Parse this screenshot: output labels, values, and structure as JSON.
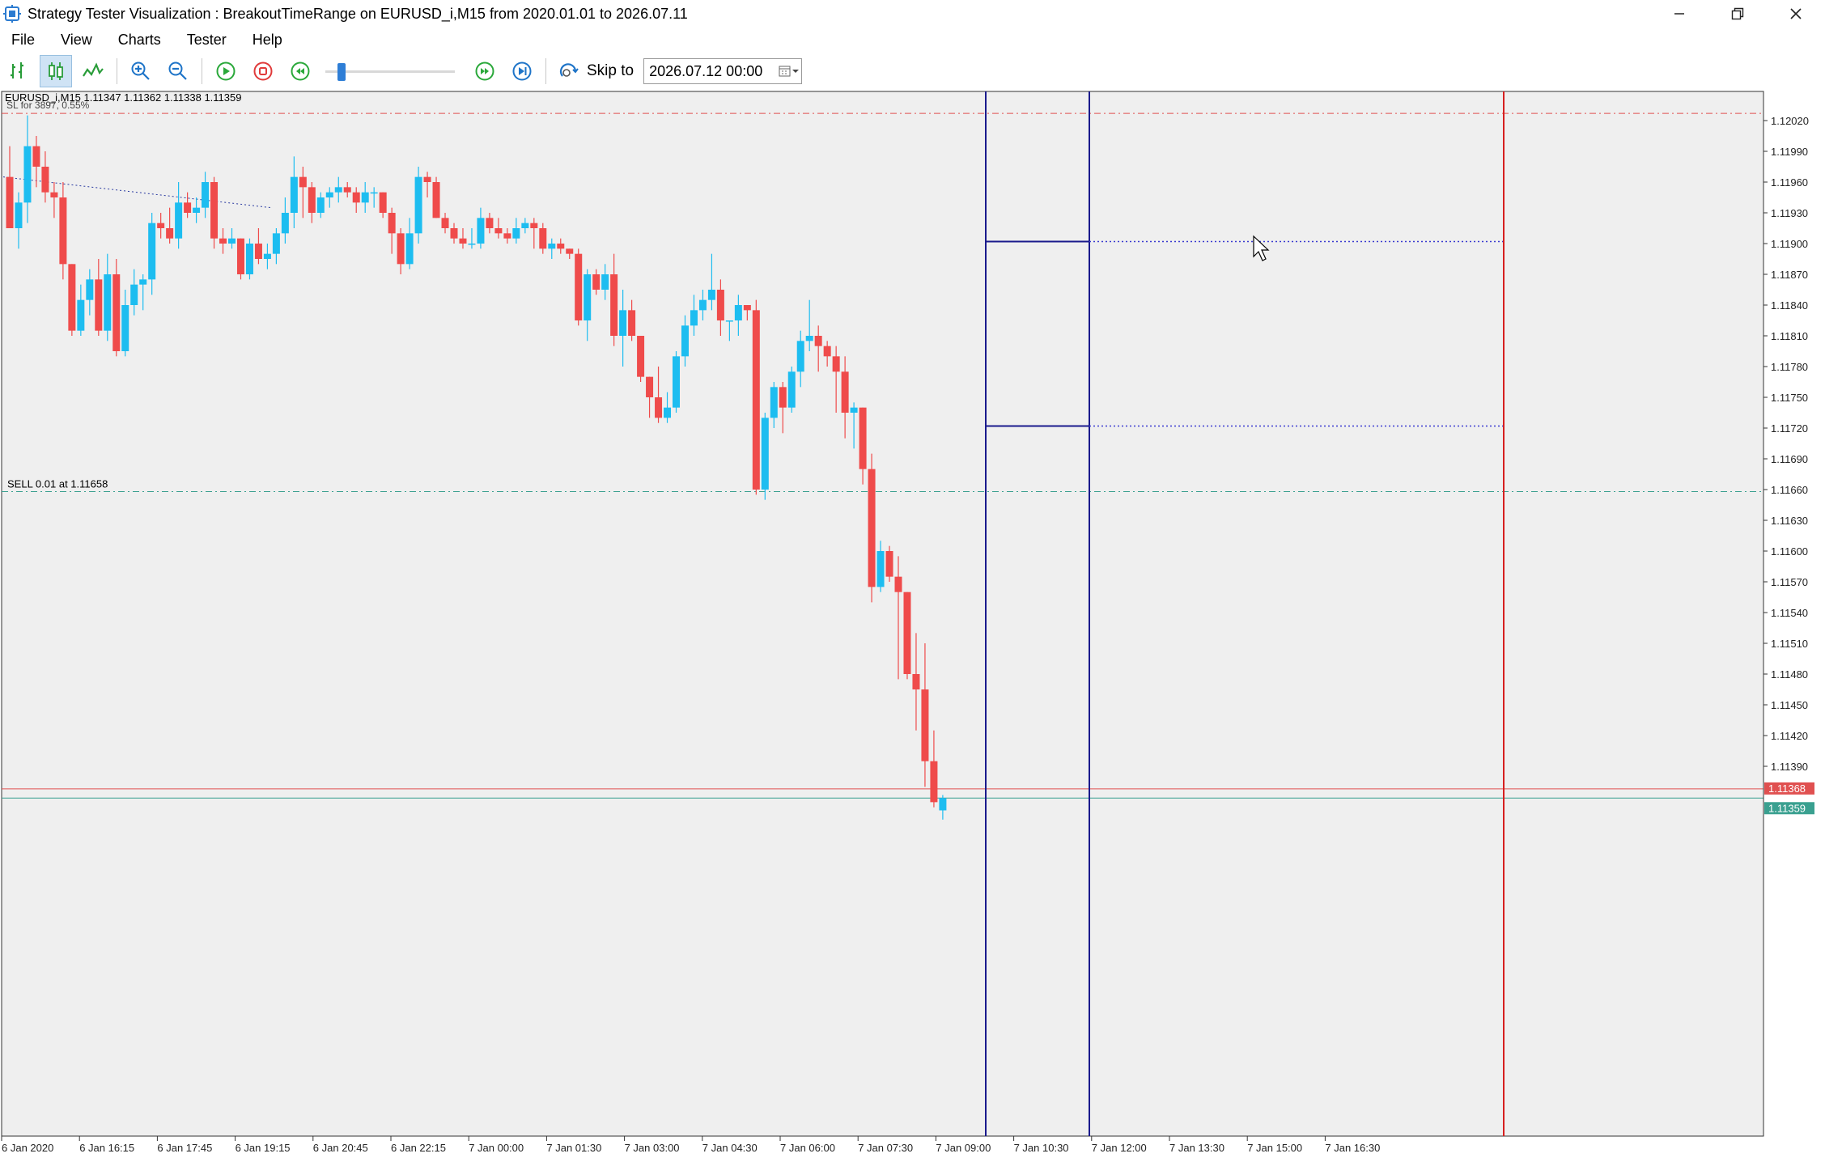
{
  "window": {
    "title": "Strategy Tester Visualization : BreakoutTimeRange on EURUSD_i,M15 from 2020.01.01 to 2026.07.11",
    "minimize_icon": "minimize-icon",
    "restore_icon": "restore-icon",
    "close_icon": "close-icon"
  },
  "menu": [
    {
      "label": "File"
    },
    {
      "label": "View"
    },
    {
      "label": "Charts"
    },
    {
      "label": "Tester"
    },
    {
      "label": "Help"
    }
  ],
  "toolbar": {
    "skip_label": "Skip to",
    "date_value": "2026.07.12 00:00",
    "speed": 0.1
  },
  "chart": {
    "info": "EURUSD_i,M15 1.11347 1.11362 1.11338 1.11359",
    "sl_text": "SL for 3897, 0.55%",
    "sell_text": "SELL 0.01 at 1.11658",
    "colors": {
      "bull": "#1dbdf0",
      "bear": "#ef4b4b",
      "bg": "#efefef",
      "range": "#1a1a8c",
      "vline": "#d61f1f"
    },
    "price_axis": [
      "1.12020",
      "1.11990",
      "1.11960",
      "1.11930",
      "1.11900",
      "1.11870",
      "1.11840",
      "1.11810",
      "1.11780",
      "1.11750",
      "1.11720",
      "1.11690",
      "1.11660",
      "1.11630",
      "1.11600",
      "1.11570",
      "1.11540",
      "1.11510",
      "1.11480",
      "1.11450",
      "1.11420",
      "1.11390"
    ],
    "time_axis": [
      "6 Jan 2020",
      "6 Jan 16:15",
      "6 Jan 17:45",
      "6 Jan 19:15",
      "6 Jan 20:45",
      "6 Jan 22:15",
      "7 Jan 00:00",
      "7 Jan 01:30",
      "7 Jan 03:00",
      "7 Jan 04:30",
      "7 Jan 06:00",
      "7 Jan 07:30",
      "7 Jan 09:00",
      "7 Jan 10:30",
      "7 Jan 12:00",
      "7 Jan 13:30",
      "7 Jan 15:00",
      "7 Jan 16:30"
    ],
    "ask_label": "1.11368",
    "bid_label": "1.11359",
    "levels": {
      "sl": 1.12027,
      "sell": 1.11658,
      "ask": 1.11368,
      "bid": 1.11359,
      "range_high": 1.11902,
      "range_low": 1.11722
    },
    "candles": [
      [
        1.11965,
        1.11995,
        1.11915,
        1.11915
      ],
      [
        1.11915,
        1.1195,
        1.11895,
        1.1194
      ],
      [
        1.1194,
        1.12025,
        1.1192,
        1.11995
      ],
      [
        1.11995,
        1.12005,
        1.11955,
        1.11975
      ],
      [
        1.11975,
        1.1199,
        1.1194,
        1.1195
      ],
      [
        1.1195,
        1.1196,
        1.11925,
        1.11945
      ],
      [
        1.11945,
        1.1196,
        1.11865,
        1.1188
      ],
      [
        1.1188,
        1.1188,
        1.1181,
        1.11815
      ],
      [
        1.11815,
        1.1186,
        1.1181,
        1.11845
      ],
      [
        1.11845,
        1.11875,
        1.1183,
        1.11865
      ],
      [
        1.11865,
        1.11885,
        1.1181,
        1.11815
      ],
      [
        1.11815,
        1.1189,
        1.11805,
        1.1187
      ],
      [
        1.1187,
        1.11885,
        1.1179,
        1.11795
      ],
      [
        1.11795,
        1.11855,
        1.1179,
        1.1184
      ],
      [
        1.1184,
        1.11875,
        1.1183,
        1.1186
      ],
      [
        1.1186,
        1.1187,
        1.11835,
        1.11865
      ],
      [
        1.11865,
        1.1193,
        1.1185,
        1.1192
      ],
      [
        1.1192,
        1.1193,
        1.11905,
        1.11915
      ],
      [
        1.11915,
        1.11935,
        1.119,
        1.11905
      ],
      [
        1.11905,
        1.1196,
        1.11895,
        1.1194
      ],
      [
        1.1194,
        1.1195,
        1.11925,
        1.1193
      ],
      [
        1.1193,
        1.11945,
        1.1192,
        1.11935
      ],
      [
        1.11935,
        1.1197,
        1.11925,
        1.1196
      ],
      [
        1.1196,
        1.11965,
        1.11895,
        1.11905
      ],
      [
        1.11905,
        1.11915,
        1.1189,
        1.119
      ],
      [
        1.119,
        1.11915,
        1.11895,
        1.11905
      ],
      [
        1.11905,
        1.11905,
        1.11865,
        1.1187
      ],
      [
        1.1187,
        1.11905,
        1.11865,
        1.119
      ],
      [
        1.119,
        1.11915,
        1.1188,
        1.11885
      ],
      [
        1.11885,
        1.119,
        1.11875,
        1.1189
      ],
      [
        1.1189,
        1.11915,
        1.1188,
        1.1191
      ],
      [
        1.1191,
        1.11945,
        1.119,
        1.1193
      ],
      [
        1.1193,
        1.11985,
        1.11915,
        1.11965
      ],
      [
        1.11965,
        1.11975,
        1.11925,
        1.11955
      ],
      [
        1.11955,
        1.1196,
        1.1192,
        1.1193
      ],
      [
        1.1193,
        1.1195,
        1.11925,
        1.11945
      ],
      [
        1.11945,
        1.11955,
        1.11935,
        1.1195
      ],
      [
        1.1195,
        1.11965,
        1.1194,
        1.11955
      ],
      [
        1.11955,
        1.1196,
        1.11945,
        1.1195
      ],
      [
        1.1195,
        1.11955,
        1.1193,
        1.1194
      ],
      [
        1.1194,
        1.1196,
        1.1193,
        1.1195
      ],
      [
        1.1195,
        1.11955,
        1.11935,
        1.1195
      ],
      [
        1.1195,
        1.1195,
        1.11925,
        1.1193
      ],
      [
        1.1193,
        1.11935,
        1.1189,
        1.1191
      ],
      [
        1.1191,
        1.11915,
        1.1187,
        1.1188
      ],
      [
        1.1188,
        1.11925,
        1.11875,
        1.1191
      ],
      [
        1.1191,
        1.11975,
        1.119,
        1.11965
      ],
      [
        1.11965,
        1.1197,
        1.11945,
        1.1196
      ],
      [
        1.1196,
        1.11965,
        1.11925,
        1.11925
      ],
      [
        1.11925,
        1.1193,
        1.1191,
        1.11915
      ],
      [
        1.11915,
        1.1192,
        1.119,
        1.11905
      ],
      [
        1.11905,
        1.11915,
        1.11895,
        1.119
      ],
      [
        1.119,
        1.11915,
        1.11895,
        1.119
      ],
      [
        1.119,
        1.11935,
        1.11895,
        1.11925
      ],
      [
        1.11925,
        1.1193,
        1.1191,
        1.11915
      ],
      [
        1.11915,
        1.11925,
        1.11905,
        1.1191
      ],
      [
        1.1191,
        1.11915,
        1.119,
        1.11905
      ],
      [
        1.11905,
        1.11925,
        1.119,
        1.11915
      ],
      [
        1.11915,
        1.11925,
        1.1191,
        1.1192
      ],
      [
        1.1192,
        1.11925,
        1.11895,
        1.11915
      ],
      [
        1.11915,
        1.1192,
        1.1189,
        1.11895
      ],
      [
        1.11895,
        1.11905,
        1.11885,
        1.119
      ],
      [
        1.119,
        1.11905,
        1.1189,
        1.11895
      ],
      [
        1.11895,
        1.11895,
        1.11885,
        1.1189
      ],
      [
        1.1189,
        1.11895,
        1.1182,
        1.11825
      ],
      [
        1.11825,
        1.11875,
        1.11805,
        1.1187
      ],
      [
        1.1187,
        1.11875,
        1.1185,
        1.11855
      ],
      [
        1.11855,
        1.1188,
        1.11845,
        1.1187
      ],
      [
        1.1187,
        1.1189,
        1.118,
        1.1181
      ],
      [
        1.1181,
        1.11855,
        1.1178,
        1.11835
      ],
      [
        1.11835,
        1.11845,
        1.11805,
        1.1181
      ],
      [
        1.1181,
        1.1181,
        1.11765,
        1.1177
      ],
      [
        1.1177,
        1.1177,
        1.1173,
        1.1175
      ],
      [
        1.1175,
        1.1178,
        1.11725,
        1.1173
      ],
      [
        1.1173,
        1.11755,
        1.11725,
        1.1174
      ],
      [
        1.1174,
        1.11795,
        1.11735,
        1.1179
      ],
      [
        1.1179,
        1.1183,
        1.1178,
        1.1182
      ],
      [
        1.1182,
        1.1185,
        1.1181,
        1.11835
      ],
      [
        1.11835,
        1.11855,
        1.11825,
        1.11845
      ],
      [
        1.11845,
        1.1189,
        1.11835,
        1.11855
      ],
      [
        1.11855,
        1.11865,
        1.1181,
        1.11825
      ],
      [
        1.11825,
        1.11825,
        1.11805,
        1.11825
      ],
      [
        1.11825,
        1.1185,
        1.1181,
        1.1184
      ],
      [
        1.1184,
        1.1184,
        1.11825,
        1.11835
      ],
      [
        1.11835,
        1.11845,
        1.11655,
        1.1166
      ],
      [
        1.1166,
        1.11735,
        1.1165,
        1.1173
      ],
      [
        1.1173,
        1.11765,
        1.1172,
        1.1176
      ],
      [
        1.1176,
        1.11765,
        1.11715,
        1.1174
      ],
      [
        1.1174,
        1.1178,
        1.11735,
        1.11775
      ],
      [
        1.11775,
        1.11815,
        1.1176,
        1.11805
      ],
      [
        1.11805,
        1.11845,
        1.11795,
        1.1181
      ],
      [
        1.1181,
        1.1182,
        1.11775,
        1.118
      ],
      [
        1.118,
        1.11805,
        1.1178,
        1.1179
      ],
      [
        1.1179,
        1.118,
        1.11735,
        1.11775
      ],
      [
        1.11775,
        1.1179,
        1.1171,
        1.11735
      ],
      [
        1.11735,
        1.11745,
        1.117,
        1.1174
      ],
      [
        1.1174,
        1.1174,
        1.11665,
        1.1168
      ],
      [
        1.1168,
        1.11695,
        1.1155,
        1.11565
      ],
      [
        1.11565,
        1.1161,
        1.1156,
        1.116
      ],
      [
        1.116,
        1.11605,
        1.1157,
        1.11575
      ],
      [
        1.11575,
        1.11595,
        1.11475,
        1.1156
      ],
      [
        1.1156,
        1.1156,
        1.11475,
        1.1148
      ],
      [
        1.1148,
        1.1152,
        1.11425,
        1.11465
      ],
      [
        1.11465,
        1.1151,
        1.1137,
        1.11395
      ],
      [
        1.11395,
        1.11425,
        1.1135,
        1.11355
      ],
      [
        1.11347,
        1.11362,
        1.11338,
        1.11359
      ]
    ]
  }
}
